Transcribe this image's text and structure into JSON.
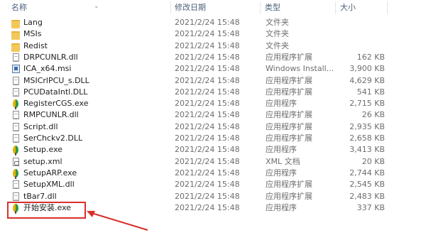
{
  "header": {
    "col_name": "名称",
    "col_date": "修改日期",
    "col_type": "类型",
    "col_size": "大小"
  },
  "files": [
    {
      "name": "Lang",
      "date": "2021/2/24 15:48",
      "type": "文件夹",
      "size": "",
      "icon": "folder-icon"
    },
    {
      "name": "MSIs",
      "date": "2021/2/24 15:48",
      "type": "文件夹",
      "size": "",
      "icon": "folder-icon"
    },
    {
      "name": "Redist",
      "date": "2021/2/24 15:48",
      "type": "文件夹",
      "size": "",
      "icon": "folder-icon"
    },
    {
      "name": "DRPCUNLR.dll",
      "date": "2021/2/24 15:48",
      "type": "应用程序扩展",
      "size": "162 KB",
      "icon": "dll-icon"
    },
    {
      "name": "ICA_x64.msi",
      "date": "2021/2/24 15:48",
      "type": "Windows Install...",
      "size": "3,900 KB",
      "icon": "msi-icon"
    },
    {
      "name": "MSICrlPCU_s.DLL",
      "date": "2021/2/24 15:48",
      "type": "应用程序扩展",
      "size": "4,629 KB",
      "icon": "dll-icon"
    },
    {
      "name": "PCUDataIntl.DLL",
      "date": "2021/2/24 15:48",
      "type": "应用程序扩展",
      "size": "541 KB",
      "icon": "dll-icon"
    },
    {
      "name": "RegisterCGS.exe",
      "date": "2021/2/24 15:48",
      "type": "应用程序",
      "size": "2,715 KB",
      "icon": "exe-icon"
    },
    {
      "name": "RMPCUNLR.dll",
      "date": "2021/2/24 15:48",
      "type": "应用程序扩展",
      "size": "26 KB",
      "icon": "dll-icon"
    },
    {
      "name": "Script.dll",
      "date": "2021/2/24 15:48",
      "type": "应用程序扩展",
      "size": "2,935 KB",
      "icon": "dll-icon"
    },
    {
      "name": "SerChckv2.DLL",
      "date": "2021/2/24 15:48",
      "type": "应用程序扩展",
      "size": "2,658 KB",
      "icon": "dll-icon"
    },
    {
      "name": "Setup.exe",
      "date": "2021/2/24 15:48",
      "type": "应用程序",
      "size": "3,413 KB",
      "icon": "exe-icon"
    },
    {
      "name": "setup.xml",
      "date": "2021/2/24 15:48",
      "type": "XML 文档",
      "size": "20 KB",
      "icon": "xml-icon"
    },
    {
      "name": "SetupARP.exe",
      "date": "2021/2/24 15:48",
      "type": "应用程序",
      "size": "2,744 KB",
      "icon": "exe-icon"
    },
    {
      "name": "SetupXML.dll",
      "date": "2021/2/24 15:48",
      "type": "应用程序扩展",
      "size": "2,545 KB",
      "icon": "dll-icon"
    },
    {
      "name": "tBar7.dll",
      "date": "2021/2/24 15:48",
      "type": "应用程序扩展",
      "size": "2,483 KB",
      "icon": "dll-icon"
    },
    {
      "name": "开始安装.exe",
      "date": "2021/2/24 15:48",
      "type": "应用程序",
      "size": "337 KB",
      "icon": "exe-icon"
    }
  ],
  "highlight_color": "#d9302b",
  "header_color": "#4c607a"
}
